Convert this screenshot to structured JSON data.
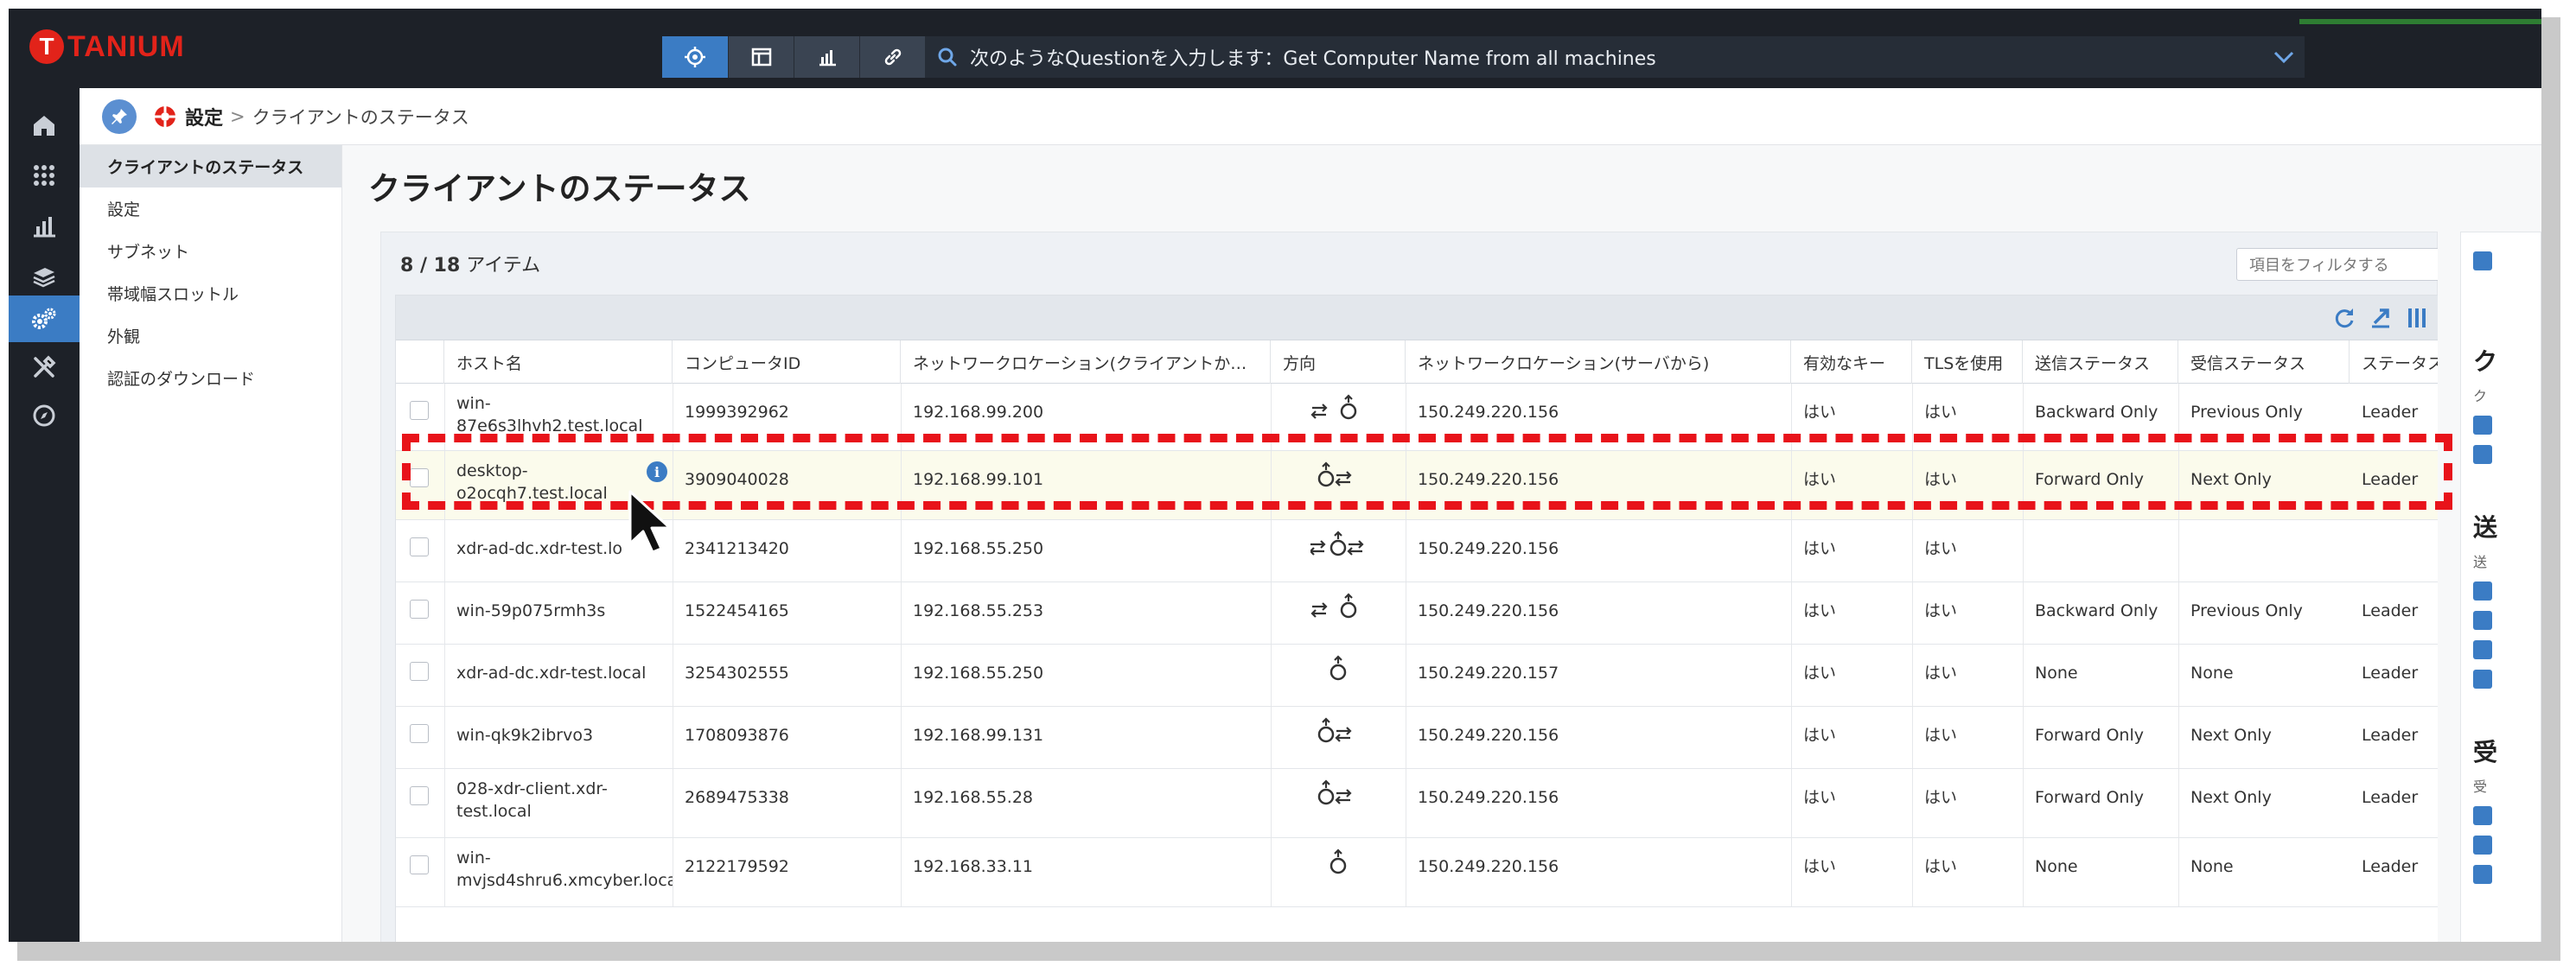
{
  "app": {
    "logo_text": "TANIUM",
    "logo_mark": "T",
    "accent": "#3b7cc4",
    "brand": "#e2231a",
    "highlight": "#e8131a"
  },
  "topnav": {
    "buttons": [
      {
        "icon": "crosshair-icon"
      },
      {
        "icon": "browser-icon"
      },
      {
        "icon": "chart-icon"
      },
      {
        "icon": "link-icon"
      }
    ],
    "search_text": "次のようなQuestionを入力します：Get Computer Name from all machines"
  },
  "rail": [
    "home-icon",
    "grid-icon",
    "chart-icon",
    "layers-icon",
    "gears-icon",
    "tools-icon",
    "compass-icon"
  ],
  "breadcrumb": {
    "root": "設定",
    "separator": ">",
    "current": "クライアントのステータス"
  },
  "sidenav": {
    "items": [
      {
        "label": "クライアントのステータス",
        "active": true
      },
      {
        "label": "設定"
      },
      {
        "label": "サブネット"
      },
      {
        "label": "帯域幅スロットル"
      },
      {
        "label": "外観"
      },
      {
        "label": "認証のダウンロード"
      }
    ]
  },
  "page": {
    "title": "クライアントのステータス"
  },
  "table": {
    "count_shown": "8",
    "count_sep": " / ",
    "count_total": "18",
    "count_unit": " アイテム",
    "filter_placeholder": "項目をフィルタする",
    "columns": [
      "ホスト名",
      "コンピュータID",
      "ネットワークロケーション(クライアントか…",
      "方向",
      "ネットワークロケーション(サーバから)",
      "有効なキー",
      "TLSを使用",
      "送信ステータス",
      "受信ステータス",
      "ステータス"
    ],
    "rows": [
      {
        "host": [
          "win-",
          "87e6s3lhvh2.test.local"
        ],
        "id": "1999392962",
        "client_loc": "192.168.99.200",
        "dir": "in",
        "server_loc": "150.249.220.156",
        "valid_key": "はい",
        "tls": "はい",
        "send": "Backward Only",
        "recv": "Previous Only",
        "status": "Leader"
      },
      {
        "host": [
          "desktop-",
          "o2ocqh7.test.local"
        ],
        "id": "3909040028",
        "client_loc": "192.168.99.101",
        "dir": "out",
        "server_loc": "150.249.220.156",
        "valid_key": "はい",
        "tls": "はい",
        "send": "Forward Only",
        "recv": "Next Only",
        "status": "Leader",
        "highlighted": true
      },
      {
        "host": [
          "xdr-ad-dc.xdr-test.lo"
        ],
        "id": "2341213420",
        "client_loc": "192.168.55.250",
        "dir": "both",
        "server_loc": "150.249.220.156",
        "valid_key": "はい",
        "tls": "はい",
        "send": "",
        "recv": "",
        "status": ""
      },
      {
        "host": [
          "win-59p075rmh3s"
        ],
        "id": "1522454165",
        "client_loc": "192.168.55.253",
        "dir": "in",
        "server_loc": "150.249.220.156",
        "valid_key": "はい",
        "tls": "はい",
        "send": "Backward Only",
        "recv": "Previous Only",
        "status": "Leader"
      },
      {
        "host": [
          "xdr-ad-dc.xdr-test.local"
        ],
        "id": "3254302555",
        "client_loc": "192.168.55.250",
        "dir": "none",
        "server_loc": "150.249.220.157",
        "valid_key": "はい",
        "tls": "はい",
        "send": "None",
        "recv": "None",
        "status": "Leader"
      },
      {
        "host": [
          "win-qk9k2ibrvo3"
        ],
        "id": "1708093876",
        "client_loc": "192.168.99.131",
        "dir": "out",
        "server_loc": "150.249.220.156",
        "valid_key": "はい",
        "tls": "はい",
        "send": "Forward Only",
        "recv": "Next Only",
        "status": "Leader"
      },
      {
        "host": [
          "028-xdr-client.xdr-",
          "test.local"
        ],
        "id": "2689475338",
        "client_loc": "192.168.55.28",
        "dir": "out",
        "server_loc": "150.249.220.156",
        "valid_key": "はい",
        "tls": "はい",
        "send": "Forward Only",
        "recv": "Next Only",
        "status": "Leader"
      },
      {
        "host": [
          "win-",
          "mvjsd4shru6.xmcyber.loca"
        ],
        "id": "2122179592",
        "client_loc": "192.168.33.11",
        "dir": "none",
        "server_loc": "150.249.220.156",
        "valid_key": "はい",
        "tls": "はい",
        "send": "None",
        "recv": "None",
        "status": "Leader"
      }
    ]
  },
  "right_panel": {
    "headings": [
      "ク",
      "送",
      "受"
    ],
    "subs": [
      "ク",
      "送",
      "受"
    ]
  }
}
